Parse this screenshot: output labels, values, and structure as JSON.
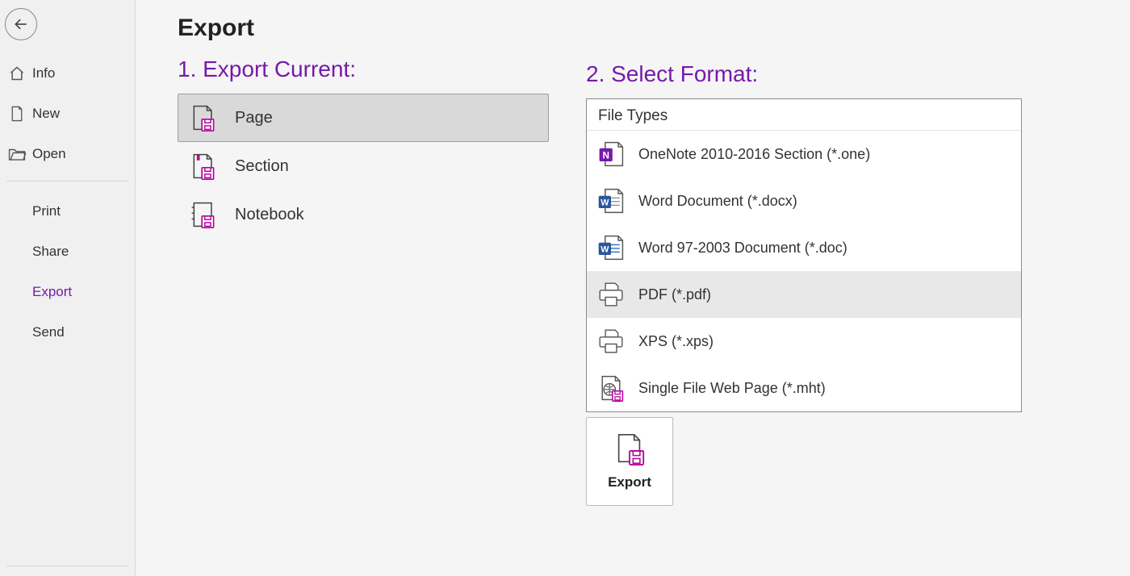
{
  "sidebar": {
    "items": [
      {
        "key": "info",
        "label": "Info",
        "icon": "home-icon",
        "indent": false
      },
      {
        "key": "new",
        "label": "New",
        "icon": "page-icon",
        "indent": false
      },
      {
        "key": "open",
        "label": "Open",
        "icon": "folder-icon",
        "indent": false
      },
      {
        "key": "print",
        "label": "Print",
        "icon": null,
        "indent": true
      },
      {
        "key": "share",
        "label": "Share",
        "icon": null,
        "indent": true
      },
      {
        "key": "export",
        "label": "Export",
        "icon": null,
        "indent": true,
        "active": true
      },
      {
        "key": "send",
        "label": "Send",
        "icon": null,
        "indent": true
      }
    ]
  },
  "page": {
    "title": "Export",
    "step1_title": "1. Export Current:",
    "step2_title": "2. Select Format:"
  },
  "scopes": [
    {
      "key": "page",
      "label": "Page",
      "selected": true
    },
    {
      "key": "section",
      "label": "Section",
      "selected": false
    },
    {
      "key": "notebook",
      "label": "Notebook",
      "selected": false
    }
  ],
  "formats": {
    "header": "File Types",
    "items": [
      {
        "key": "one",
        "label": "OneNote 2010-2016 Section (*.one)",
        "icon": "onenote-file-icon"
      },
      {
        "key": "docx",
        "label": "Word Document (*.docx)",
        "icon": "word-file-icon"
      },
      {
        "key": "doc",
        "label": "Word 97-2003 Document (*.doc)",
        "icon": "word-legacy-file-icon"
      },
      {
        "key": "pdf",
        "label": "PDF (*.pdf)",
        "icon": "printer-file-icon",
        "hover": true
      },
      {
        "key": "xps",
        "label": "XPS (*.xps)",
        "icon": "printer-file-icon"
      },
      {
        "key": "mht",
        "label": "Single File Web Page (*.mht)",
        "icon": "web-file-icon"
      }
    ]
  },
  "export_button": {
    "label": "Export"
  },
  "colors": {
    "accent": "#7719AA"
  }
}
